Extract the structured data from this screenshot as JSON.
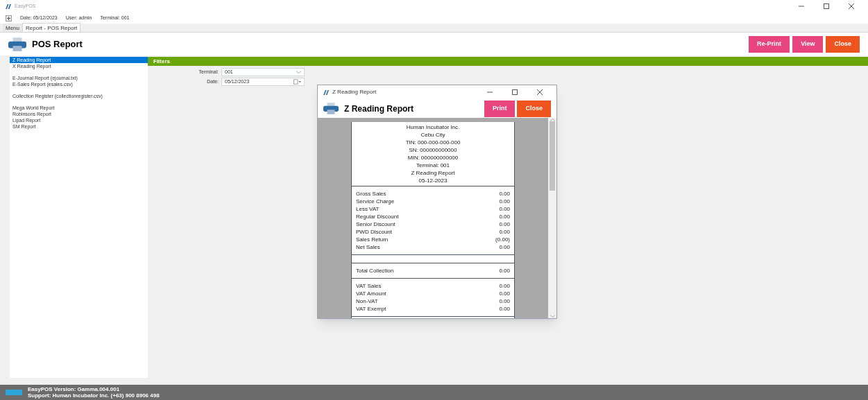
{
  "window": {
    "title": "EasyPOS"
  },
  "info_bar": {
    "date": "Date: 05/12/2023",
    "user": "User: admin",
    "terminal": "Terminal: 001"
  },
  "tabs": [
    {
      "label": "Menu",
      "selected": false
    },
    {
      "label": "Report - POS Report",
      "selected": true
    }
  ],
  "header": {
    "title": "POS Report",
    "buttons": [
      {
        "label": "Re-Print",
        "kind": "pink"
      },
      {
        "label": "View",
        "kind": "pink"
      },
      {
        "label": "Close",
        "kind": "orange"
      }
    ]
  },
  "report_list": [
    [
      {
        "label": "Z Reading Report",
        "selected": true
      },
      {
        "label": "X Reading Report",
        "selected": false
      }
    ],
    [
      {
        "label": "E-Journal Report (ejournal.txt)",
        "selected": false
      },
      {
        "label": "E-Sales Report (esales.csv)",
        "selected": false
      }
    ],
    [
      {
        "label": "Collection Register (collectionregister.csv)",
        "selected": false
      }
    ],
    [
      {
        "label": "Mega World Report",
        "selected": false
      },
      {
        "label": "Robinsons Report",
        "selected": false
      },
      {
        "label": "Lipad Report",
        "selected": false
      },
      {
        "label": "SM Report",
        "selected": false
      }
    ]
  ],
  "filters": {
    "title": "Filters",
    "fields": [
      {
        "label": "Terminal:",
        "value": "001",
        "kind": "dropdown"
      },
      {
        "label": "Date:",
        "value": "05/12/2023",
        "kind": "date"
      }
    ]
  },
  "dialog": {
    "title": "Z Reading Report",
    "heading": "Z Reading Report",
    "buttons": [
      {
        "label": "Print",
        "kind": "pink"
      },
      {
        "label": "Close",
        "kind": "orange"
      }
    ],
    "receipt": {
      "header_lines": [
        "Human Incubator Inc.",
        "Cebu City",
        "TIN: 000-000-000-000",
        "SN: 000000000000",
        "MIN: 000000000000",
        "Terminal: 001",
        "Z Reading Report",
        "05-12-2023"
      ],
      "sections": [
        {
          "kind": "rows",
          "rows": [
            {
              "label": "Gross Sales",
              "value": "0.00"
            },
            {
              "label": "Service Charge",
              "value": "0.00"
            },
            {
              "label": "Less VAT",
              "value": "0.00"
            },
            {
              "label": "Regular Discount",
              "value": "0.00"
            },
            {
              "label": "Senior Discount",
              "value": "0.00"
            },
            {
              "label": "PWD Discount",
              "value": "0.00"
            },
            {
              "label": "Sales Return",
              "value": "(0.00)"
            },
            {
              "label": "Net Sales",
              "value": "0.00"
            }
          ]
        },
        {
          "kind": "spacer"
        },
        {
          "kind": "rows",
          "rows": [
            {
              "label": "Total Collection",
              "value": "0.00"
            }
          ]
        },
        {
          "kind": "rows",
          "rows": [
            {
              "label": "VAT Sales",
              "value": "0.00"
            },
            {
              "label": "VAT Amount",
              "value": "0.00"
            },
            {
              "label": "Non-VAT",
              "value": "0.00"
            },
            {
              "label": "VAT Exempt",
              "value": "0.00"
            }
          ]
        }
      ]
    }
  },
  "status_bar": {
    "version": "EasyPOS Version: Gamma.004.001",
    "support": "Support: Human Incubator Inc. (+63) 900 8906 498"
  }
}
